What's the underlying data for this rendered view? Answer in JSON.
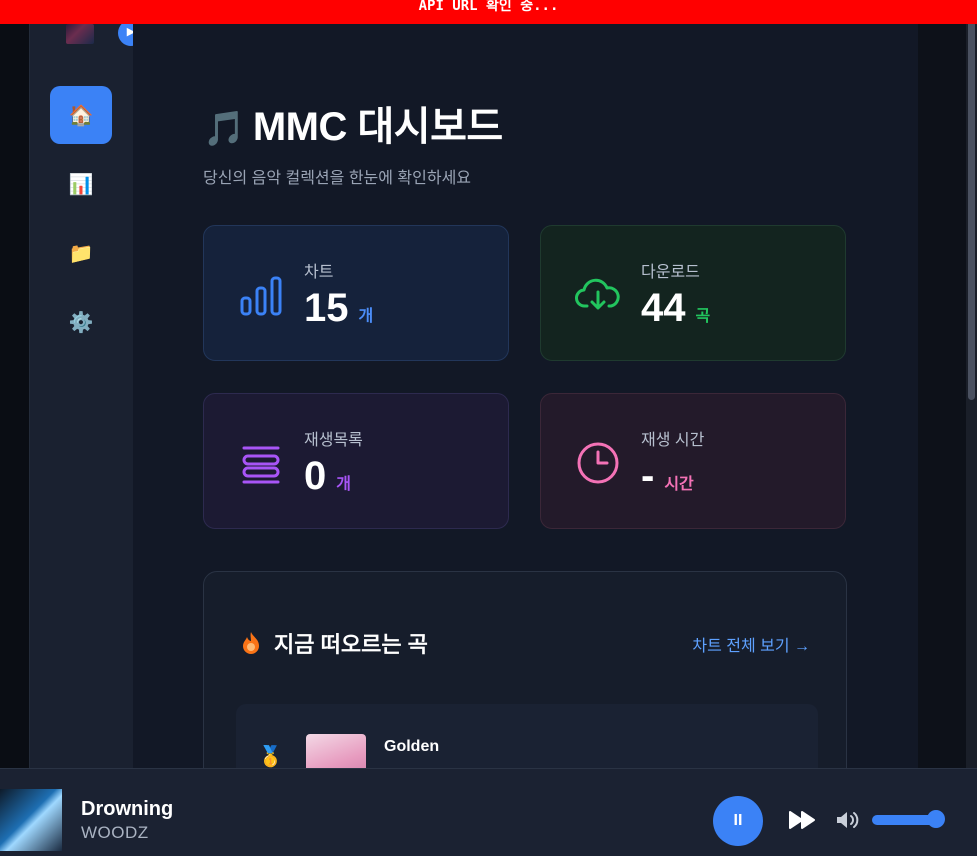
{
  "banner": {
    "text": "API URL 확인 중..."
  },
  "sidebar": {
    "items": [
      {
        "name": "home",
        "icon": "home-icon",
        "glyph": "🏠",
        "active": true
      },
      {
        "name": "charts",
        "icon": "bar-chart-icon",
        "glyph": "📊",
        "active": false
      },
      {
        "name": "folder",
        "icon": "folder-icon",
        "glyph": "📁",
        "active": false
      },
      {
        "name": "settings",
        "icon": "gear-icon",
        "glyph": "⚙️",
        "active": false
      }
    ]
  },
  "header": {
    "title_icon": "🎵",
    "title": "MMC 대시보드",
    "subtitle": "당신의 음악 컬렉션을 한눈에 확인하세요"
  },
  "stats": {
    "charts": {
      "label": "차트",
      "value": "15",
      "unit": "개",
      "color": "#3b82f6"
    },
    "downloads": {
      "label": "다운로드",
      "value": "44",
      "unit": "곡",
      "color": "#22c55e"
    },
    "playlists": {
      "label": "재생목록",
      "value": "0",
      "unit": "개",
      "color": "#a855f7"
    },
    "playtime": {
      "label": "재생 시간",
      "value": "-",
      "unit": "시간",
      "color": "#f472b6"
    }
  },
  "trending": {
    "title": "지금 떠오르는 곡",
    "link": "차트 전체 보기 →",
    "songs": [
      {
        "rank_icon": "🥇",
        "title": "Golden"
      }
    ]
  },
  "player": {
    "title": "Drowning",
    "artist": "WOODZ",
    "pause_glyph": "II",
    "volume": 1.0,
    "accent": "#3b82f6"
  }
}
